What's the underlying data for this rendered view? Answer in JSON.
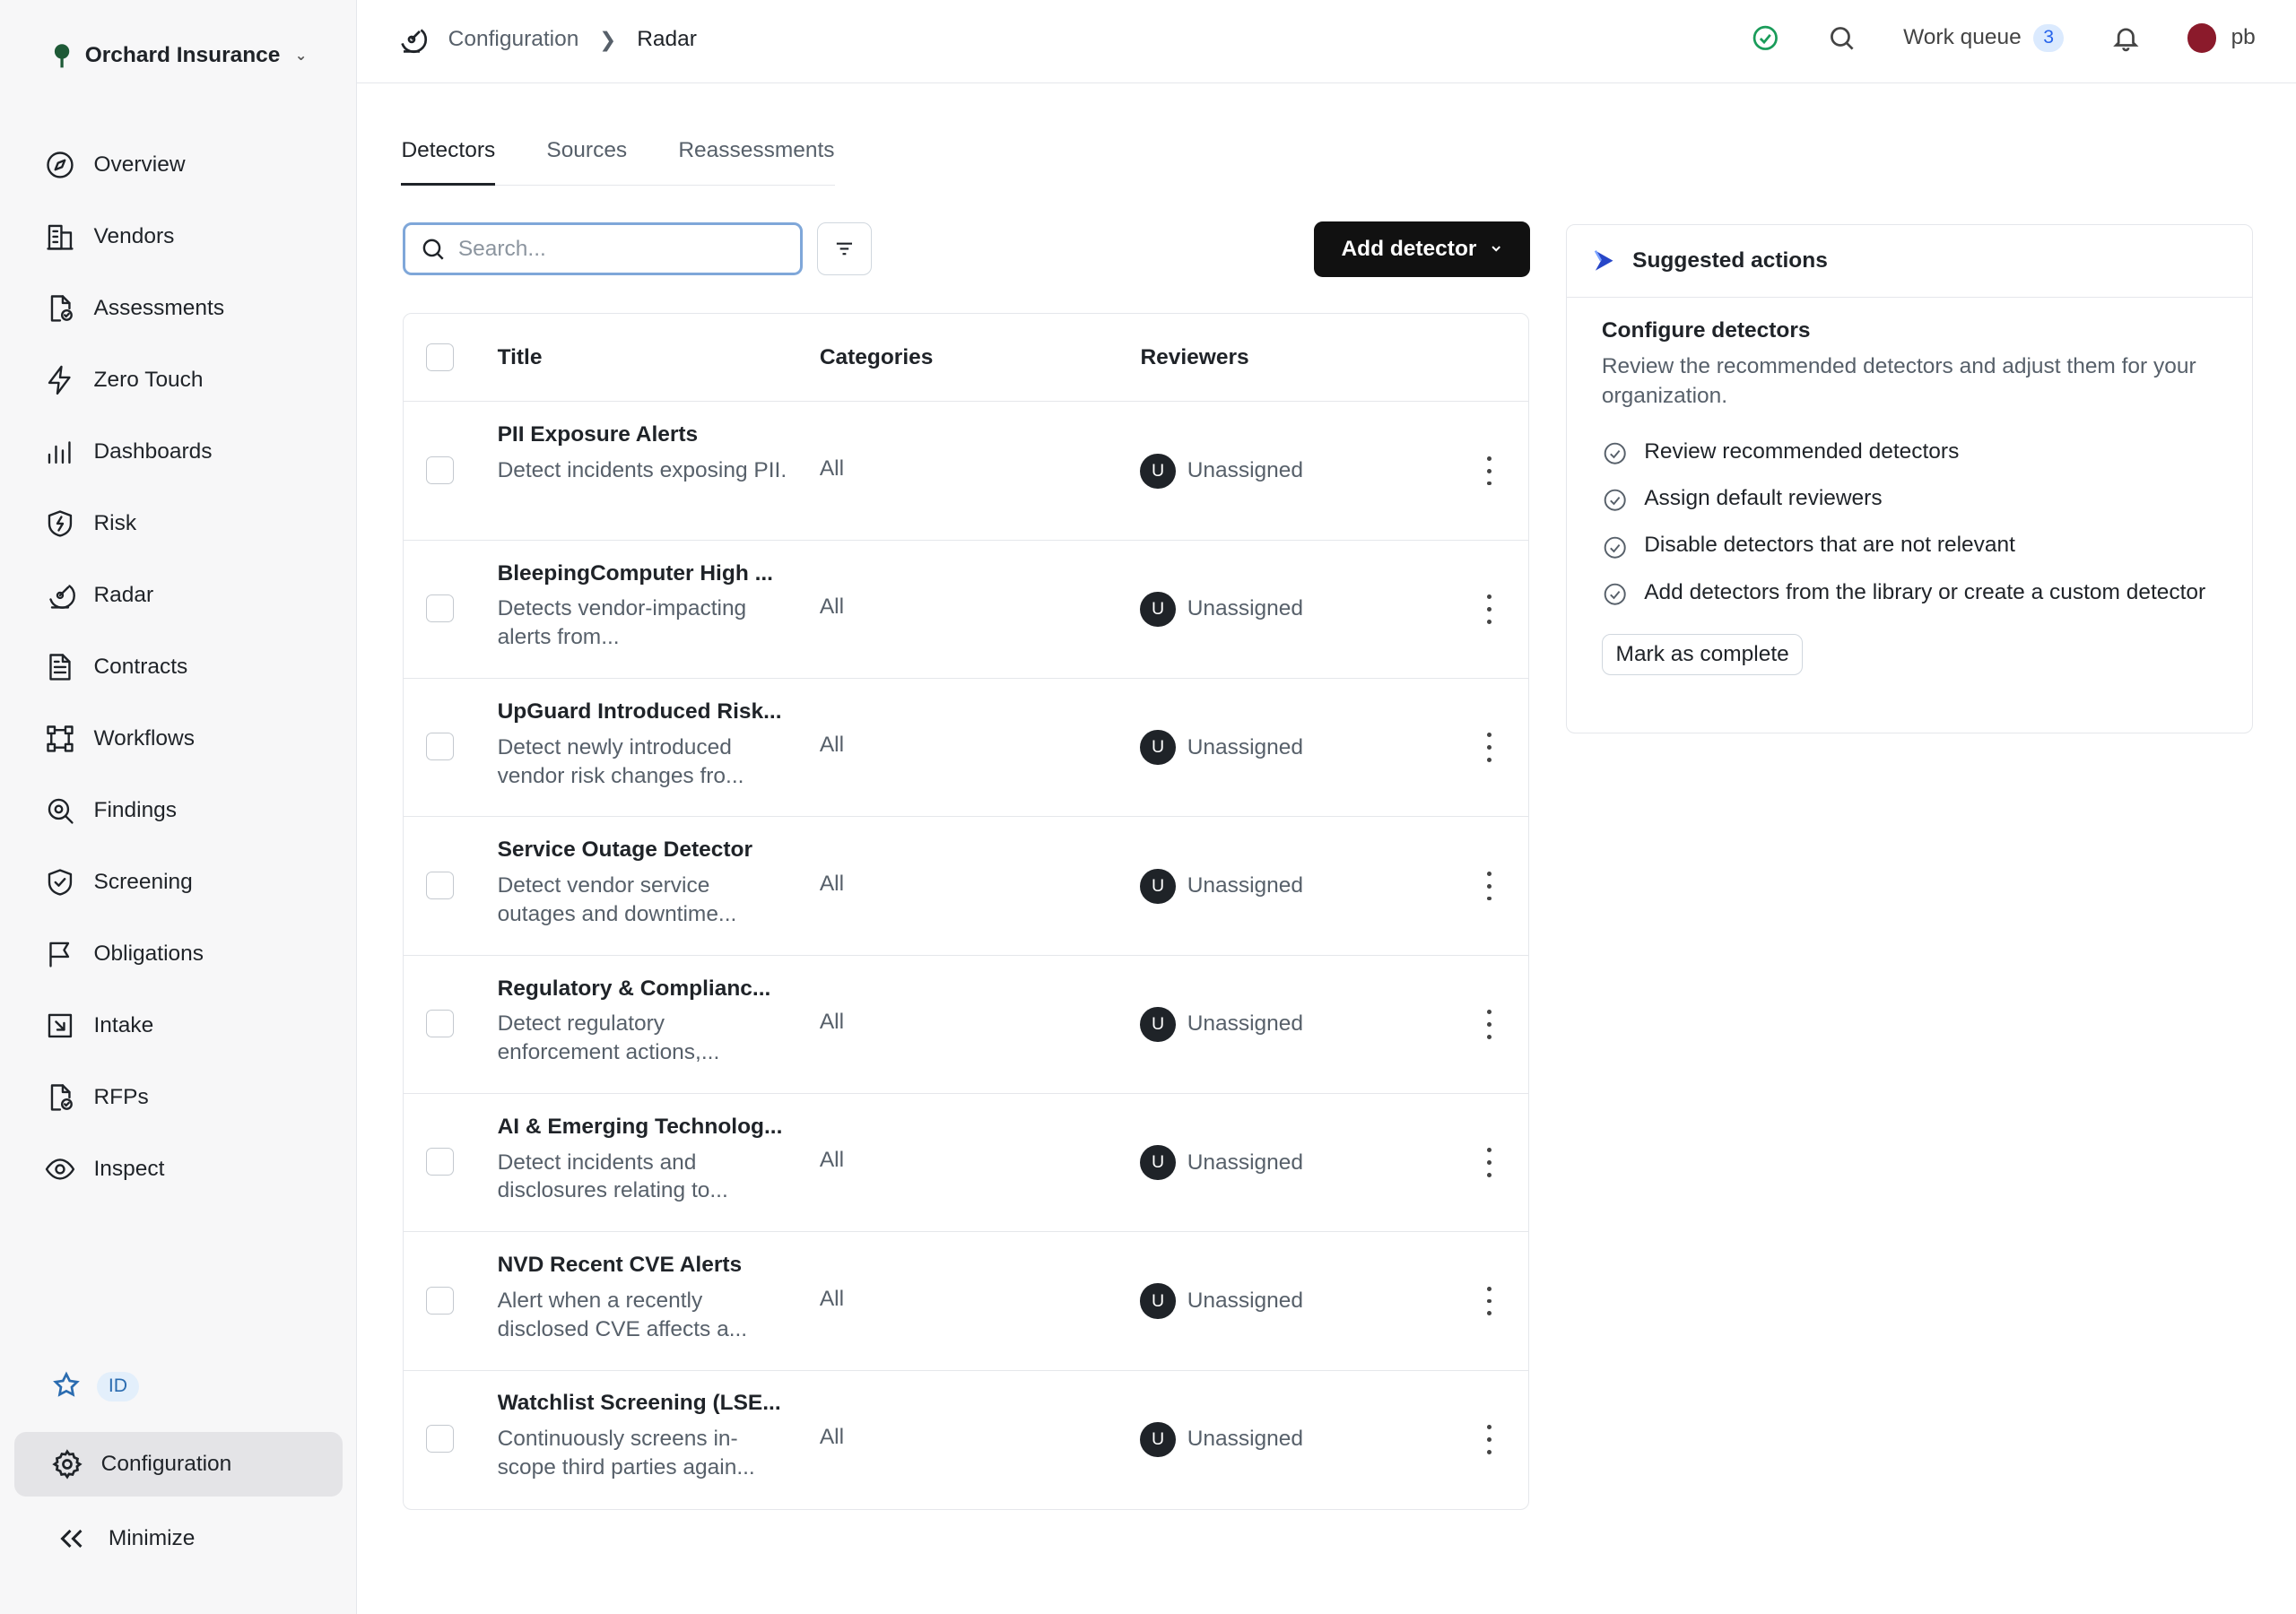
{
  "org": {
    "name": "Orchard Insurance"
  },
  "nav": [
    {
      "label": "Overview",
      "icon": "compass-icon"
    },
    {
      "label": "Vendors",
      "icon": "building-icon"
    },
    {
      "label": "Assessments",
      "icon": "file-check-icon"
    },
    {
      "label": "Zero Touch",
      "icon": "bolt-icon"
    },
    {
      "label": "Dashboards",
      "icon": "bar-chart-icon"
    },
    {
      "label": "Risk",
      "icon": "shield-bolt-icon"
    },
    {
      "label": "Radar",
      "icon": "radar-icon"
    },
    {
      "label": "Contracts",
      "icon": "document-icon"
    },
    {
      "label": "Workflows",
      "icon": "workflow-icon"
    },
    {
      "label": "Findings",
      "icon": "magnifier-icon"
    },
    {
      "label": "Screening",
      "icon": "shield-check-icon"
    },
    {
      "label": "Obligations",
      "icon": "flag-icon"
    },
    {
      "label": "Intake",
      "icon": "intake-icon"
    },
    {
      "label": "RFPs",
      "icon": "file-check-icon"
    },
    {
      "label": "Inspect",
      "icon": "eye-icon"
    }
  ],
  "sidebar_bottom": {
    "id_badge": "ID",
    "configuration": "Configuration",
    "minimize": "Minimize"
  },
  "breadcrumb": {
    "parent": "Configuration",
    "current": "Radar"
  },
  "header": {
    "work_queue": "Work queue",
    "work_queue_count": "3",
    "user": "pb"
  },
  "tabs": [
    "Detectors",
    "Sources",
    "Reassessments"
  ],
  "search": {
    "placeholder": "Search..."
  },
  "add_detector": "Add detector",
  "table": {
    "headers": {
      "title": "Title",
      "categories": "Categories",
      "reviewers": "Reviewers"
    },
    "rows": [
      {
        "title": "PII Exposure Alerts",
        "desc": "Detect incidents exposing PII.",
        "category": "All",
        "avatar": "U",
        "reviewer": "Unassigned"
      },
      {
        "title": "BleepingComputer High ...",
        "desc": "Detects vendor-impacting alerts from...",
        "category": "All",
        "avatar": "U",
        "reviewer": "Unassigned"
      },
      {
        "title": "UpGuard Introduced Risk...",
        "desc": "Detect newly introduced vendor risk changes fro...",
        "category": "All",
        "avatar": "U",
        "reviewer": "Unassigned"
      },
      {
        "title": "Service Outage Detector",
        "desc": "Detect vendor service outages and downtime...",
        "category": "All",
        "avatar": "U",
        "reviewer": "Unassigned"
      },
      {
        "title": "Regulatory & Complianc...",
        "desc": "Detect regulatory enforcement actions,...",
        "category": "All",
        "avatar": "U",
        "reviewer": "Unassigned"
      },
      {
        "title": "AI & Emerging Technolog...",
        "desc": "Detect incidents and disclosures relating to...",
        "category": "All",
        "avatar": "U",
        "reviewer": "Unassigned"
      },
      {
        "title": "NVD Recent CVE Alerts",
        "desc": "Alert when a recently disclosed CVE affects a...",
        "category": "All",
        "avatar": "U",
        "reviewer": "Unassigned"
      },
      {
        "title": "Watchlist Screening (LSE...",
        "desc": "Continuously screens in-scope third parties again...",
        "category": "All",
        "avatar": "U",
        "reviewer": "Unassigned"
      }
    ]
  },
  "suggested": {
    "title": "Suggested actions",
    "heading": "Configure detectors",
    "subtitle": "Review the recommended detectors and adjust them for your organization.",
    "items": [
      "Review recommended detectors",
      "Assign default reviewers",
      "Disable detectors that are not relevant",
      "Add detectors from the library or create a custom detector"
    ],
    "button": "Mark as complete"
  }
}
